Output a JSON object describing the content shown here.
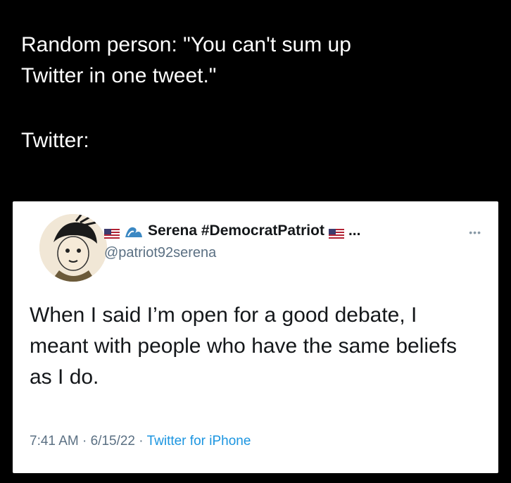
{
  "caption": {
    "line1": "Random person: \"You can't sum up",
    "line2": "Twitter in one tweet.\"",
    "line3": "Twitter:"
  },
  "tweet": {
    "display_name": "Serena #DemocratPatriot",
    "name_truncation": "...",
    "handle": "@patriot92serena",
    "text": "When I said I’m open for a good debate, I meant with people who have the same beliefs as I do.",
    "time": "7:41 AM",
    "separator1": " · ",
    "date": "6/15/22",
    "separator2": " · ",
    "source": "Twitter for iPhone",
    "icons": [
      "us-flag-icon",
      "wave-icon",
      "us-flag-icon",
      "more-icon"
    ]
  },
  "colors": {
    "background": "#000000",
    "card": "#ffffff",
    "secondary_text": "#5b7083",
    "link": "#1b95e0"
  }
}
